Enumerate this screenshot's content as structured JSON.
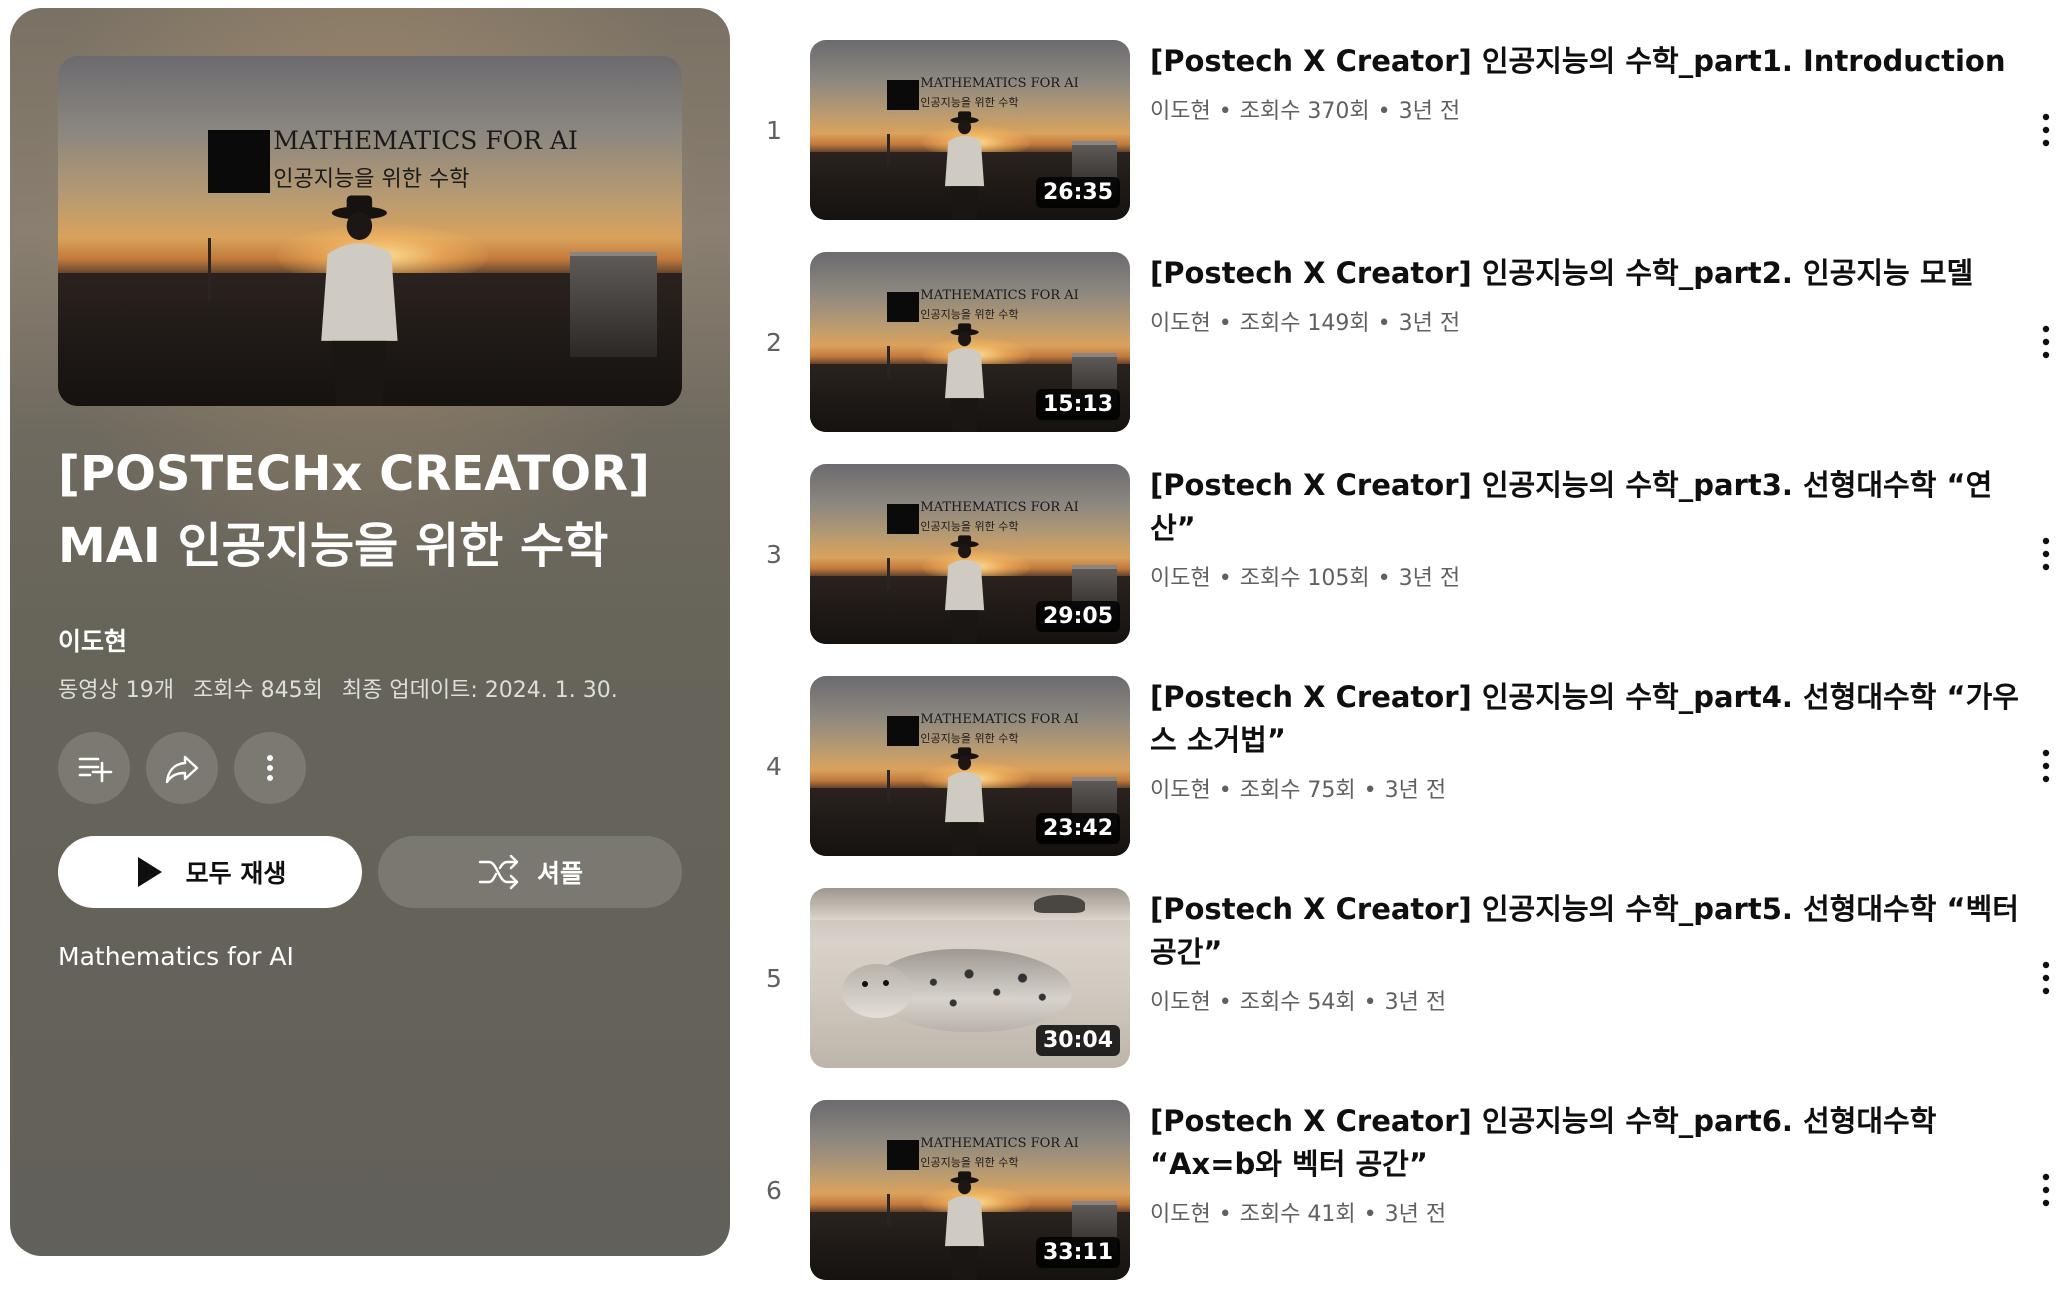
{
  "playlist": {
    "title_line1": "[POSTECHx CREATOR]",
    "title_line2": "MAI 인공지능을 위한 수학",
    "owner": "이도현",
    "video_count": "동영상 19개",
    "view_count": "조회수 845회",
    "updated": "최종 업데이트: 2024. 1. 30.",
    "description": "Mathematics for AI",
    "thumbnail_text_line1": "MATHEMATICS FOR AI",
    "thumbnail_text_line2": "인공지능을 위한 수학"
  },
  "actions": {
    "save_icon": "playlist-add-icon",
    "share_icon": "share-icon",
    "more_icon": "more-vertical-icon",
    "play_all_label": "모두 재생",
    "play_icon": "play-icon",
    "shuffle_label": "셔플",
    "shuffle_icon": "shuffle-icon"
  },
  "colors": {
    "panel_background": "#67645a",
    "title_text": "#0f0f0f",
    "meta_text": "#606060"
  },
  "videos": [
    {
      "index": "1",
      "title": "[Postech X Creator] 인공지능의 수학_part1. Introduction",
      "channel": "이도현",
      "views": "조회수 370회",
      "age": "3년 전",
      "duration": "26:35",
      "thumb_text_line1": "MATHEMATICS FOR AI",
      "thumb_text_line2": "인공지능을 위한 수학"
    },
    {
      "index": "2",
      "title": "[Postech X Creator] 인공지능의 수학_part2. 인공지능 모델",
      "channel": "이도현",
      "views": "조회수 149회",
      "age": "3년 전",
      "duration": "15:13",
      "thumb_text_line1": "MATHEMATICS FOR AI",
      "thumb_text_line2": "인공지능을 위한 수학"
    },
    {
      "index": "3",
      "title": "[Postech X Creator] 인공지능의 수학_part3. 선형대수학 “연산”",
      "channel": "이도현",
      "views": "조회수 105회",
      "age": "3년 전",
      "duration": "29:05",
      "thumb_text_line1": "MATHEMATICS FOR AI",
      "thumb_text_line2": "인공지능을 위한 수학"
    },
    {
      "index": "4",
      "title": "[Postech X Creator] 인공지능의 수학_part4. 선형대수학 “가우스 소거법”",
      "channel": "이도현",
      "views": "조회수 75회",
      "age": "3년 전",
      "duration": "23:42",
      "thumb_text_line1": "MATHEMATICS FOR AI",
      "thumb_text_line2": "인공지능을 위한 수학"
    },
    {
      "index": "5",
      "title": "[Postech X Creator] 인공지능의 수학_part5. 선형대수학 “벡터 공간”",
      "channel": "이도현",
      "views": "조회수 54회",
      "age": "3년 전",
      "duration": "30:04"
    },
    {
      "index": "6",
      "title": "[Postech X Creator] 인공지능의 수학_part6. 선형대수학 “Ax=b와 벡터 공간”",
      "channel": "이도현",
      "views": "조회수 41회",
      "age": "3년 전",
      "duration": "33:11",
      "thumb_text_line1": "MATHEMATICS FOR AI",
      "thumb_text_line2": "인공지능을 위한 수학"
    }
  ]
}
